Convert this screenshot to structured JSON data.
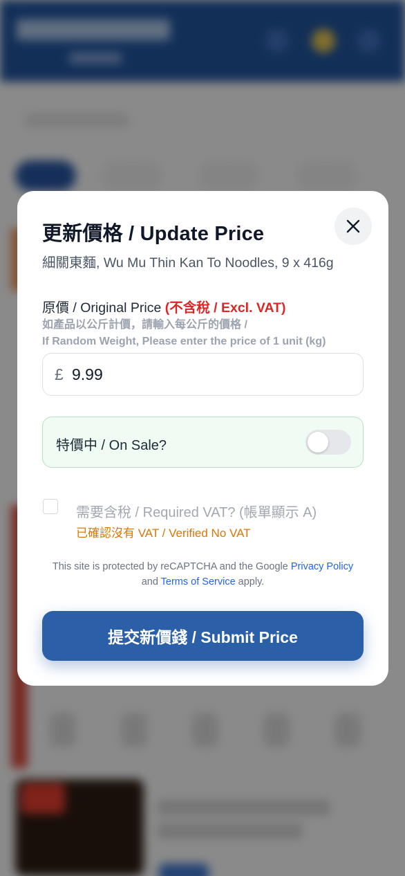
{
  "modal": {
    "title": "更新價格 / Update Price",
    "product_name": "細關東麵, Wu Mu Thin Kan To Noodles, 9 x 416g",
    "close_icon": "close-icon"
  },
  "price": {
    "label": "原價 / Original Price ",
    "vat_note": "(不含稅 / Excl. VAT)",
    "hint_line1": "如產品以公斤計價，請輸入每公斤的價格 /",
    "hint_line2": "If Random Weight, Please enter the price of 1 unit (kg)",
    "currency_symbol": "£",
    "value": "9.99"
  },
  "sale": {
    "label": "特價中 / On Sale?",
    "enabled": false
  },
  "vat": {
    "label": "需要含稅 / Required VAT? (帳單顯示 A)",
    "status": "已確認沒有 VAT / Verified No VAT",
    "checked": false
  },
  "recaptcha": {
    "text_before": "This site is protected by reCAPTCHA and the Google ",
    "privacy_link": "Privacy Policy",
    "text_and": "and ",
    "terms_link": "Terms of Service",
    "text_after": " apply."
  },
  "submit_label": "提交新價錢 / Submit Price",
  "colors": {
    "accent": "#2b5fa8",
    "vat_red": "#dc2626",
    "status_orange": "#d97706",
    "sale_bg": "#f0fbf3"
  }
}
